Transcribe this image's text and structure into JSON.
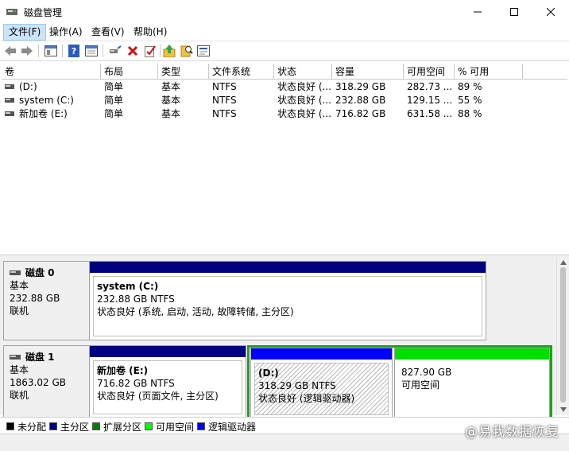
{
  "window": {
    "title": "磁盘管理"
  },
  "menu": [
    "文件(F)",
    "操作(A)",
    "查看(V)",
    "帮助(H)"
  ],
  "toolbar": [
    "back-icon",
    "forward-icon",
    "console-tree-icon",
    "help-icon",
    "properties-icon",
    "connect-icon",
    "delete-icon",
    "check-icon",
    "export-icon",
    "search-icon",
    "refresh-icon"
  ],
  "volume_table": {
    "headers": [
      "卷",
      "布局",
      "类型",
      "文件系统",
      "状态",
      "容量",
      "可用空间",
      "% 可用"
    ],
    "rows": [
      [
        "(D:)",
        "简单",
        "基本",
        "NTFS",
        "状态良好 (...",
        "318.29 GB",
        "282.73 ...",
        "89 %"
      ],
      [
        "system (C:)",
        "简单",
        "基本",
        "NTFS",
        "状态良好 (...",
        "232.88 GB",
        "129.15 ...",
        "55 %"
      ],
      [
        "新加卷 (E:)",
        "简单",
        "基本",
        "NTFS",
        "状态良好 (...",
        "716.82 GB",
        "631.58 ...",
        "88 %"
      ]
    ]
  },
  "disks": [
    {
      "name": "磁盘 0",
      "type": "基本",
      "size": "232.88 GB",
      "status": "联机",
      "partitions": [
        {
          "name": "system  (C:)",
          "size": "232.88 GB NTFS",
          "status": "状态良好 (系统, 启动, 活动, 故障转储, 主分区)"
        }
      ]
    },
    {
      "name": "磁盘 1",
      "type": "基本",
      "size": "1863.02 GB",
      "status": "联机",
      "partitions": [
        {
          "name": "新加卷  (E:)",
          "size": "716.82 GB NTFS",
          "status": "状态良好 (页面文件, 主分区)"
        },
        {
          "name": "(D:)",
          "size": "318.29 GB NTFS",
          "status": "状态良好 (逻辑驱动器)"
        },
        {
          "name": "",
          "size": "827.90 GB",
          "status": "可用空间"
        }
      ]
    }
  ],
  "legend": [
    {
      "label": "未分配",
      "color": "#000000"
    },
    {
      "label": "主分区",
      "color": "#000080"
    },
    {
      "label": "扩展分区",
      "color": "#008000"
    },
    {
      "label": "可用空间",
      "color": "#00ff00"
    },
    {
      "label": "逻辑驱动器",
      "color": "#0000ff"
    }
  ],
  "colors": {
    "primary": "#000080",
    "extended": "#20a020",
    "free": "#00e000",
    "logical": "#0000ff"
  },
  "watermark": "@易我数据恢复"
}
